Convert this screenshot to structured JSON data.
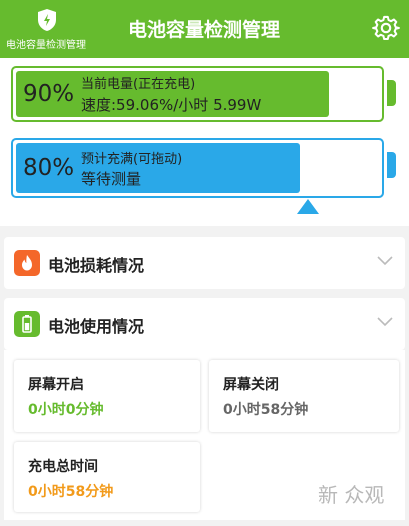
{
  "header": {
    "app_name": "电池容量检测管理",
    "title": "电池容量检测管理",
    "color": "#66bb2e"
  },
  "battery_current": {
    "percent": "90%",
    "level": 0.9,
    "status": "当前电量(正在充电)",
    "speed": "速度:59.06%/小时  5.99W",
    "color": "#66bb2e"
  },
  "battery_target": {
    "percent": "80%",
    "level": 0.8,
    "status": "预计充满(可拖动)",
    "wait": "等待测量",
    "color": "#2aa8e8"
  },
  "sections": [
    {
      "label": "电池损耗情况",
      "icon": "battery-wear-icon",
      "color": "#f4672a"
    },
    {
      "label": "电池使用情况",
      "icon": "battery-usage-icon",
      "color": "#66bb2e"
    }
  ],
  "usage": {
    "screen_on": {
      "label": "屏幕开启",
      "value": "0小时0分钟",
      "color": "#66bb2e"
    },
    "screen_off": {
      "label": "屏幕关闭",
      "value": "0小时58分钟",
      "color": "#666666"
    },
    "charge_total": {
      "label": "充电总时间",
      "value": "0小时58分钟",
      "color": "#f29a1a"
    }
  },
  "watermark": "新 众观"
}
